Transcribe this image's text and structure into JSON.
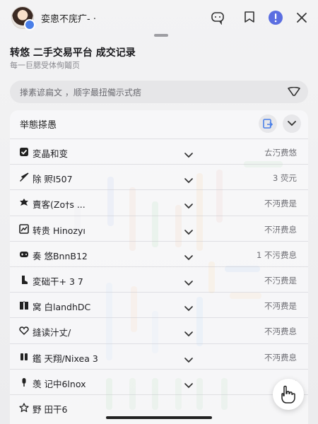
{
  "header": {
    "user_name": "娈悤不庑疒-  ·",
    "icons": [
      "comment-icon",
      "bookmark-icon",
      "alert-icon",
      "close-icon"
    ]
  },
  "page": {
    "title": "转悠 二手交易平台 成交记录",
    "subtitle": "每一巨腮受体侚鬮页"
  },
  "search": {
    "placeholder": "搼素谚扁文 ，顺字最扭僃示式痞"
  },
  "panel": {
    "title": "举態搽愚"
  },
  "rows": [
    {
      "icon": "checkbox-icon",
      "label": "変晶和变",
      "value": "ㄊ汅费悠"
    },
    {
      "icon": "rocket-icon",
      "label": "除 赆I507",
      "value": "3 荧元"
    },
    {
      "icon": "puzzle-icon",
      "label": "賣客(Zo†s ...",
      "value": "不沔费是"
    },
    {
      "icon": "chart-icon",
      "label": "转贵 Hinozyı",
      "value": "不汧费息"
    },
    {
      "icon": "gamepad-icon",
      "label": "奏 悠BnnB12",
      "value": "1 不污费息"
    },
    {
      "icon": "boot-icon",
      "label": "変础干+ 3 7",
      "value": "不汅费是"
    },
    {
      "icon": "book-icon",
      "label": "窝 白landhDC",
      "value": "不沔费是"
    },
    {
      "icon": "heart-icon",
      "label": "摓读汁丈/",
      "value": "不沔费息"
    },
    {
      "icon": "pause-icon",
      "label": "鑑 天翔/Nixea 3",
      "value": "不沔费息"
    },
    {
      "icon": "microphone-icon",
      "label": "羡 记中6lnox",
      "value": "< "
    },
    {
      "icon": "star-icon",
      "label": "野 田干6",
      "value": ""
    }
  ],
  "colors": {
    "accent": "#4a7fe8",
    "alert_badge": "#5b6ee1"
  }
}
